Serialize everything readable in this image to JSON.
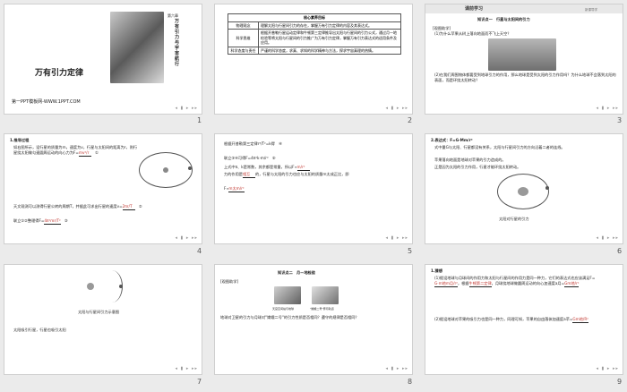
{
  "slides": {
    "s1": {
      "number": "1",
      "title": "万有引力定律",
      "chapter_tag": "第六章",
      "vertical_title": "万有引力与宇宙航行",
      "watermark": "第一PPT模板网-WWW.1PPT.COM"
    },
    "s2": {
      "number": "2",
      "header": "核心素养目标",
      "rows": [
        {
          "category": "物理观念",
          "text": "理解太阳与行星间引力的存在，掌握万有引力定律的内容及其表达式。"
        },
        {
          "category": "科学思维",
          "text": "根据开普勒行星运动定律和牛顿第三定律推导出太阳与行星间的引力公式，通过月—地检验等将太阳与行星间的引力推广为万有引力定律，掌握万有引力表达式的适用条件及应用。"
        },
        {
          "category": "科学态度与责任",
          "text": "严谨的科学态度，求真、求知的科学精神与方法，探求宇宙真理的热情。"
        }
      ]
    },
    "s3": {
      "number": "3",
      "header_tab": "课前学习",
      "header_right": "新课导学",
      "section": "知识点一　行星与太阳间的引力",
      "guide": "[观图助学]",
      "q1": "(1)为什么苹果从树上落向地面而不飞上天空？",
      "q2": "(2)在我们周围物体都要受到地球引力的作用，那么地球是受到太阳的引力作用吗？为什么地球不会落到太阳的表面，而是环绕太阳转动？"
    },
    "s4": {
      "number": "4",
      "heading": "1.推导过程",
      "p1": "如右图所示，设行星的质量为m，速度为v，行星与太阳间的距离为r，则行星绕太阳做匀速圆周运动的向心力为F=",
      "f1": "mv²/r",
      "eq1": "①",
      "p2": "天文观测可以测得行星公转的周期T，并据此可求出行星的速度v=",
      "f2": "2πr/T",
      "eq2": "②",
      "p3": "联立①②整理得F=",
      "f3": "4π²mr/T²",
      "eq3": "③"
    },
    "s5": {
      "number": "5",
      "p1": "根据开普勒第三定律r³/T²=k得",
      "eq4": "④",
      "p2": "联立③④可得F=4π²k·m/r²　⑤",
      "p3": "上式中π、k是常数，其余都是常量，所以F∝",
      "f4": "m/r²",
      "p4": "力的作用是",
      "f5": "相互",
      "p5": "的，行星与太阳的引力也应与太阳的质量m太成正比，即",
      "p6": "F∝",
      "f6": "m太m/r²"
    },
    "s6": {
      "number": "6",
      "heading": "2.表达式：F=G·Mm/r²",
      "p1": "式中量G与太阳、行星都没有关系，太阳与行星间引力的方向沿着二者的连线。",
      "p2": "苹果落向地面是地球对苹果的引力造成的。",
      "p3": "正是因为太阳的引力作用，行星才能环绕太阳转动。",
      "caption": "太阳对行星的引力"
    },
    "s7": {
      "number": "7",
      "diagram_label": "太阳与行星间引力示意图",
      "caption": "太阳吸引行星，行星也吸引太阳"
    },
    "s8": {
      "number": "8",
      "section": "知识点二　月—地检验",
      "guide": "[观图助学]",
      "img1_cap": "天宫空间站与地球",
      "img2_cap": "\"嫦娥二号\"奔月轨道",
      "q1": "地球对卫星的引力与月球对\"嫦娥二号\"的引力性质是否相同？遵守的规律是否相同？"
    },
    "s9": {
      "number": "9",
      "heading": "1.猜想",
      "p1": "(1)假设地球与月球间的作用力和太阳与行星间的作用力是同一种力，它们的表达式也应该满足F=",
      "f1": "G·m地m月/r²",
      "p2": "，根据",
      "f2": "牛顿第二定律",
      "p3": "，月球绕地球做圆周运动的向心加速度a月=",
      "f3": "Gm地/r²",
      "p4": "(2)假设地球对苹果的吸引力也是同一种力，同理可知，苹果的自由落体加速度a苹=",
      "f4": "Gm地/R²"
    }
  },
  "controls": "◂ ▮ ▸ ▸▸"
}
